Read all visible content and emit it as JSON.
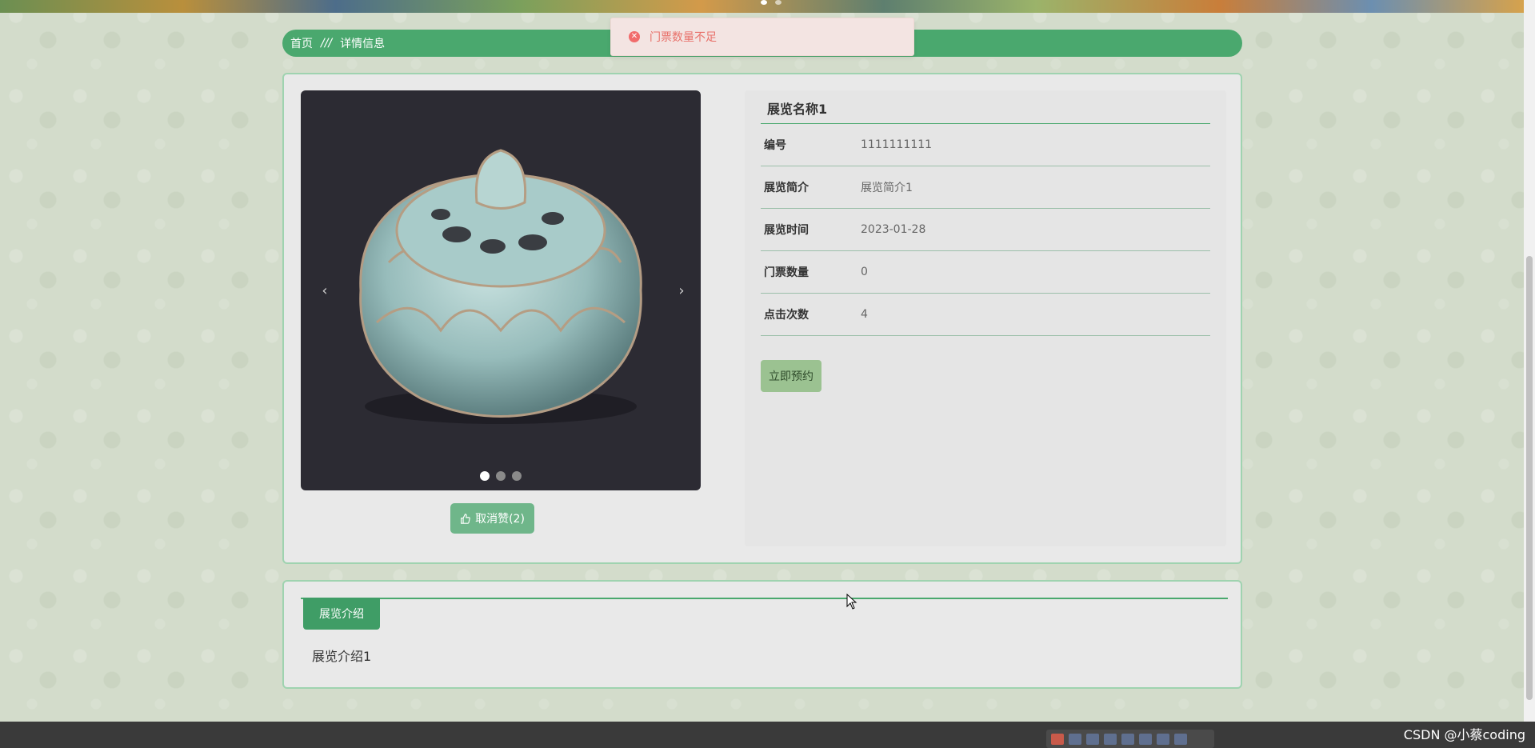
{
  "breadcrumb": {
    "home": "首页",
    "separator": "///",
    "current": "详情信息"
  },
  "toast": {
    "icon": "error-circle-icon",
    "message": "门票数量不足"
  },
  "carousel": {
    "prev": "‹",
    "next": "›",
    "slides": 3,
    "active_slide": 1
  },
  "like_button": {
    "icon": "thumbs-up-icon",
    "label": "取消赞(2)"
  },
  "exhibition": {
    "title": "展览名称1",
    "fields": [
      {
        "label": "编号",
        "value": "1111111111"
      },
      {
        "label": "展览简介",
        "value": "展览简介1"
      },
      {
        "label": "展览时间",
        "value": "2023-01-28"
      },
      {
        "label": "门票数量",
        "value": "0"
      },
      {
        "label": "点击次数",
        "value": "4"
      }
    ],
    "book_button": "立即预约"
  },
  "intro": {
    "tab": "展览介绍",
    "text": "展览介绍1"
  },
  "watermark": "CSDN @小蔡coding",
  "colors": {
    "primary": "#4aa86e",
    "toast_text": "#e8716a",
    "panel_border": "#9fd3b0"
  }
}
